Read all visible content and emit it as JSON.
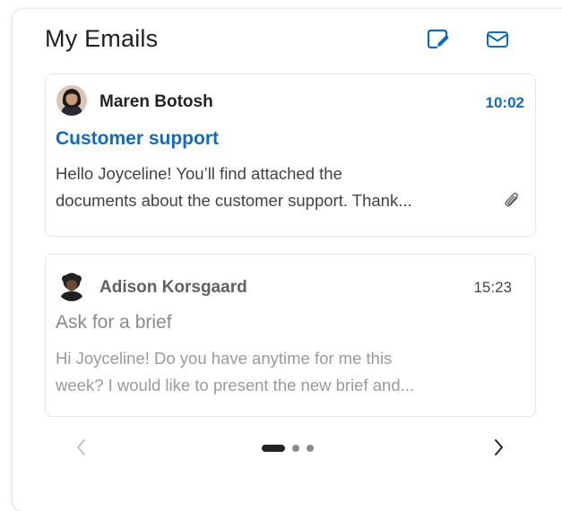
{
  "header": {
    "title": "My Emails",
    "compose_icon": "compose-icon",
    "mail_icon": "mail-icon"
  },
  "emails": [
    {
      "sender": "Maren Botosh",
      "time": "10:02",
      "subject": "Customer support",
      "preview_line1": "Hello Joyceline! You’ll find attached the",
      "preview_line2": "documents about the customer support. Thank...",
      "unread": true,
      "has_attachment": true,
      "attachment_icon": "paperclip-icon"
    },
    {
      "sender": "Adison Korsgaard",
      "time": "15:23",
      "subject": "Ask for a brief",
      "preview_line1": "Hi Joyceline! Do you have anytime for me this",
      "preview_line2": "week? I would like to present the new brief and...",
      "unread": false,
      "has_attachment": false
    }
  ],
  "pagination": {
    "total_pages": 3,
    "current_page": 1,
    "prev_icon": "chevron-left-icon",
    "next_icon": "chevron-right-icon"
  },
  "colors": {
    "accent": "#0f6cbd",
    "text_primary": "#242424",
    "text_secondary": "#424242",
    "text_muted": "#9a9a9a",
    "border": "#e6e6e6"
  }
}
